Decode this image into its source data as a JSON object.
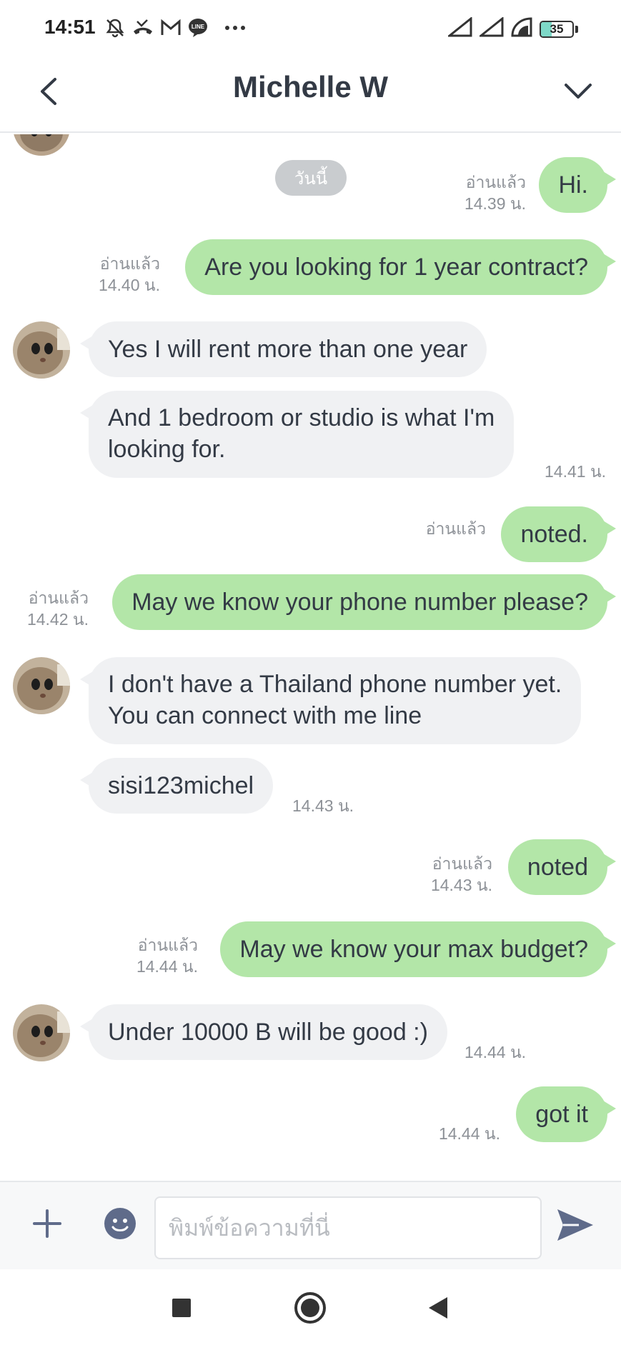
{
  "status_bar": {
    "time": "14:51",
    "battery": "35",
    "battery_level": 0.35,
    "notification_icons": [
      "mute-icon",
      "missed-call-icon",
      "gmail-icon",
      "line-icon",
      "more-icon"
    ],
    "signal_icons": [
      "signal-icon",
      "signal-icon",
      "wifi-icon"
    ]
  },
  "header": {
    "title": "Michelle W"
  },
  "chat": {
    "date_label": "วันนี้",
    "messages": [
      {
        "dir": "out",
        "text": "Hi.",
        "read": "อ่านแล้ว",
        "time": "14.39 น."
      },
      {
        "dir": "out",
        "text": "Are you looking for 1 year contract?",
        "read": "อ่านแล้ว",
        "time": "14.40 น."
      },
      {
        "dir": "in",
        "text": "Yes I will rent more than one year"
      },
      {
        "dir": "in",
        "line1": "And 1 bedroom or studio is what I'm",
        "line2": "looking for.",
        "time": "14.41 น."
      },
      {
        "dir": "out",
        "text": "noted.",
        "read": "อ่านแล้ว"
      },
      {
        "dir": "out",
        "text": "May we know your phone number please?",
        "read": "อ่านแล้ว",
        "time": "14.42 น."
      },
      {
        "dir": "in",
        "line1": "I don't have a Thailand phone number yet.",
        "line2": "You can connect with me line"
      },
      {
        "dir": "in",
        "text": "sisi123michel",
        "time": "14.43 น."
      },
      {
        "dir": "out",
        "text": "noted",
        "read": "อ่านแล้ว",
        "time": "14.43 น."
      },
      {
        "dir": "out",
        "text": "May we know your max budget?",
        "read": "อ่านแล้ว",
        "time": "14.44 น."
      },
      {
        "dir": "in",
        "text": "Under 10000 B will be good :)",
        "time": "14.44 น."
      },
      {
        "dir": "out",
        "text": "got it",
        "time": "14.44 น."
      }
    ]
  },
  "input": {
    "placeholder": "พิมพ์ข้อความที่นี่"
  },
  "colors": {
    "outgoing_bubble": "#b3e6a8",
    "incoming_bubble": "#f0f1f3",
    "accent": "#5f6b8a"
  }
}
